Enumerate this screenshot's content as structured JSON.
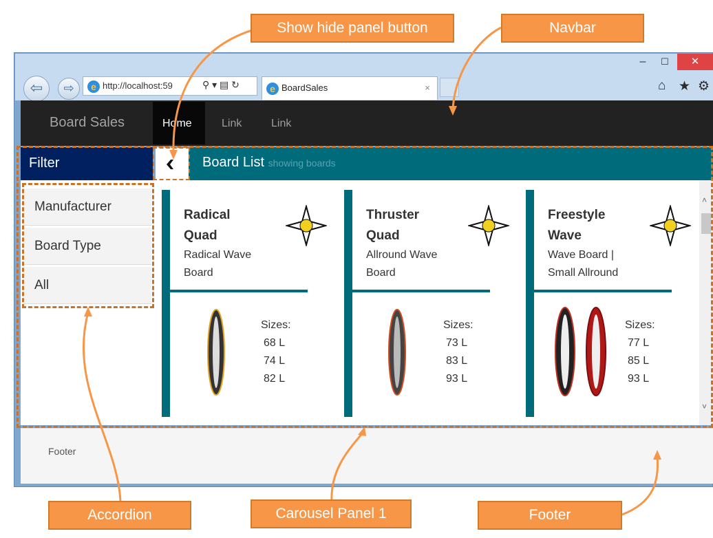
{
  "browser": {
    "address": "http://localhost:59",
    "tab_title": "BoardSales",
    "close_tab": "×",
    "win_min": "–",
    "win_max": "☐",
    "win_close": "✕"
  },
  "navbar": {
    "brand": "Board Sales",
    "links": [
      "Home",
      "Link",
      "Link"
    ]
  },
  "filter": {
    "title": "Filter",
    "items": [
      "Manufacturer",
      "Board Type",
      "All"
    ]
  },
  "board_list": {
    "title": "Board List",
    "subtitle": "showing boards"
  },
  "cards": [
    {
      "name": "Radical Quad",
      "desc": "Radical Wave Board",
      "sizes_label": "Sizes:",
      "sizes": [
        "68 L",
        "74 L",
        "82 L"
      ]
    },
    {
      "name": "Thruster Quad",
      "desc": "Allround Wave Board",
      "sizes_label": "Sizes:",
      "sizes": [
        "73 L",
        "83 L",
        "93 L"
      ]
    },
    {
      "name": "Freestyle Wave",
      "desc": "Wave Board | Small Allround",
      "sizes_label": "Sizes:",
      "sizes": [
        "77 L",
        "85 L",
        "93 L"
      ]
    }
  ],
  "footer": {
    "text": "Footer"
  },
  "annotations": {
    "show_hide": "Show hide panel button",
    "navbar": "Navbar",
    "accordion": "Accordion",
    "carousel": "Carousel Panel 1",
    "footer": "Footer"
  },
  "colors": {
    "accent_teal": "#006b7b",
    "filter_navy": "#002060",
    "callout_orange": "#f79646"
  }
}
